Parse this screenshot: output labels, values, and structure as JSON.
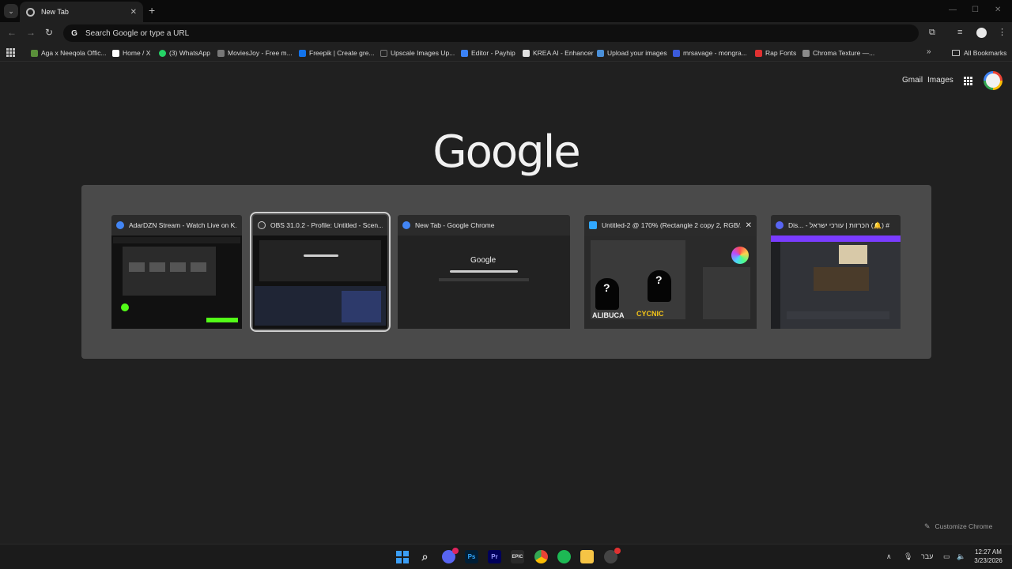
{
  "browser": {
    "tab": {
      "title": "New Tab",
      "close": "✕"
    },
    "new_tab": "+",
    "omnibox_placeholder": "Search Google or type a URL",
    "controls": {
      "minimize": "—",
      "maximize": "☐",
      "close": "✕"
    }
  },
  "bookmarks": [
    {
      "label": "Aga x Neeqola Offic...",
      "color": "#5a8f3a"
    },
    {
      "label": "Home / X",
      "color": "#ffffff"
    },
    {
      "label": "(3) WhatsApp",
      "color": "#25d366"
    },
    {
      "label": "MoviesJoy - Free m...",
      "color": "#777777"
    },
    {
      "label": "Freepik | Create gre...",
      "color": "#1273eb"
    },
    {
      "label": "Upscale Images Up...",
      "color": "#222222"
    },
    {
      "label": "Editor - Payhip",
      "color": "#3b82f6"
    },
    {
      "label": "KREA AI - Enhancer",
      "color": "#e0e0e0"
    },
    {
      "label": "Upload your images",
      "color": "#4a90d9"
    },
    {
      "label": "mrsavage - mongra...",
      "color": "#3b5bdb"
    },
    {
      "label": "Rap Fonts",
      "color": "#e03131"
    },
    {
      "label": "Chroma Texture —...",
      "color": "#8a8a8a"
    }
  ],
  "bookmarks_more": "»",
  "all_bookmarks": "All Bookmarks",
  "page": {
    "gmail": "Gmail",
    "images": "Images",
    "logo": "Google",
    "customize": "Customize Chrome"
  },
  "switcher": {
    "windows": [
      {
        "title": "AdarDZN Stream - Watch Live on K...",
        "icon_color": "#4285f4"
      },
      {
        "title": "OBS 31.0.2 - Profile: Untitled - Scen...",
        "icon_color": "#cccccc"
      },
      {
        "title": "New Tab - Google Chrome",
        "icon_color": "#4285f4",
        "thumb_logo": "Google"
      },
      {
        "title": "Untitled-2 @ 170% (Rectangle 2 copy 2, RGB/...",
        "icon_color": "#31a8ff",
        "caption_left": "ALIBUCA",
        "caption_right": "CYCNIC",
        "q": "?"
      },
      {
        "title": "Dis... - הכרזות | עורכי ישראל (🔔) #",
        "icon_color": "#5865f2"
      }
    ],
    "close": "✕"
  },
  "taskbar": {
    "apps": [
      {
        "name": "windows",
        "color": "#3b9ef5"
      },
      {
        "name": "search",
        "color": "#d0d0d0"
      },
      {
        "name": "discord",
        "color": "#5865f2"
      },
      {
        "name": "photoshop",
        "color": "#001e36",
        "label": "Ps"
      },
      {
        "name": "premiere",
        "color": "#00005b",
        "label": "Pr"
      },
      {
        "name": "epic",
        "color": "#2a2a2a",
        "label": "EPIC"
      },
      {
        "name": "chrome",
        "color": "#4285f4"
      },
      {
        "name": "spotify",
        "color": "#1db954"
      },
      {
        "name": "explorer",
        "color": "#f6c445"
      },
      {
        "name": "obs",
        "color": "#444444"
      }
    ],
    "lang": "עבר",
    "time": "12:27 AM",
    "date": "3/23/2026"
  }
}
